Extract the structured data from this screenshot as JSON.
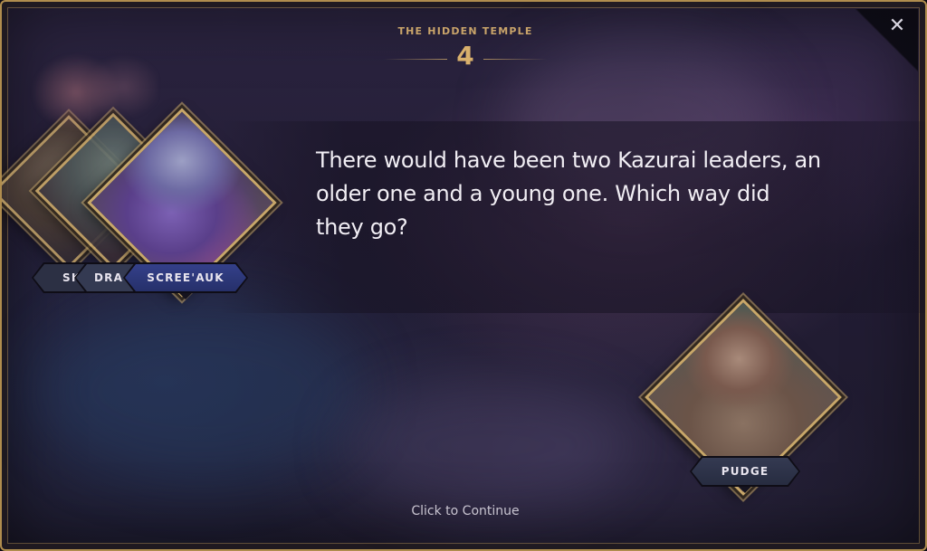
{
  "header": {
    "title": "THE HIDDEN TEMPLE",
    "number": "4"
  },
  "dialog": {
    "text": "There would have been two Kazurai leaders, an older one and a young one. Which way did they go?"
  },
  "speakers": [
    {
      "name": "SK",
      "icon": "hero-portrait-icon"
    },
    {
      "name": "DRA",
      "icon": "hero-portrait-icon"
    },
    {
      "name": "SCREE'AUK",
      "icon": "scree-auk-portrait-icon",
      "active": true
    }
  ],
  "listener": {
    "name": "PUDGE",
    "icon": "pudge-portrait-icon"
  },
  "footer": {
    "continue_label": "Click to Continue"
  },
  "controls": {
    "close_icon": "close-icon",
    "close_glyph": "✕"
  },
  "colors": {
    "accent_gold": "#c8a769",
    "nameplate_active": "#2e3a78",
    "nameplate_inactive": "#343a52"
  }
}
